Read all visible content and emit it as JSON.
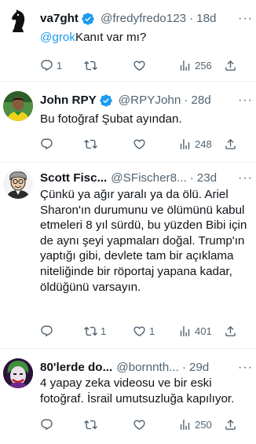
{
  "tweets": [
    {
      "name": "va7ght",
      "handle": "@fredyfredo123",
      "sep": "·",
      "time": "18d",
      "verified": true,
      "mention": "@grok",
      "text": "Kanıt var mı?",
      "replies": "1",
      "retweets": "",
      "likes": "",
      "views": "256",
      "avatar": "chess-knight"
    },
    {
      "name": "John RPY",
      "handle": "@RPYJohn",
      "sep": "·",
      "time": "28d",
      "verified": true,
      "mention": "",
      "text": "Bu fotoğraf Şubat ayından.",
      "replies": "",
      "retweets": "",
      "likes": "",
      "views": "248",
      "avatar": "player-photo"
    },
    {
      "name": "Scott Fisc...",
      "handle": "@SFischer8...",
      "sep": "·",
      "time": "23d",
      "verified": false,
      "mention": "",
      "text": "Çünkü ya ağır yaralı ya da ölü. Ariel Sharon'ın durumunu ve ölümünü kabul etmeleri 8 yıl sürdü, bu yüzden Bibi için de aynı şeyi yapmaları doğal. Trump'ın yaptığı gibi, devlete tam bir açıklama niteliğinde bir röportaj yapana kadar, öldüğünü varsayın.",
      "replies": "",
      "retweets": "1",
      "likes": "1",
      "views": "401",
      "avatar": "cartoon-portrait"
    },
    {
      "name": "80'lerde do...",
      "handle": "@bornnth...",
      "sep": "·",
      "time": "29d",
      "verified": false,
      "mention": "",
      "text": "4 yapay zeka videosu ve bir eski fotoğraf. İsrail umutsuzluğa kapılıyor.",
      "replies": "",
      "retweets": "",
      "likes": "",
      "views": "250",
      "avatar": "joker-face"
    }
  ],
  "more_label": "···",
  "colors": {
    "accent": "#1d9bf0",
    "secondary": "#536471",
    "text": "#0f1419",
    "divider": "#eff3f4"
  }
}
